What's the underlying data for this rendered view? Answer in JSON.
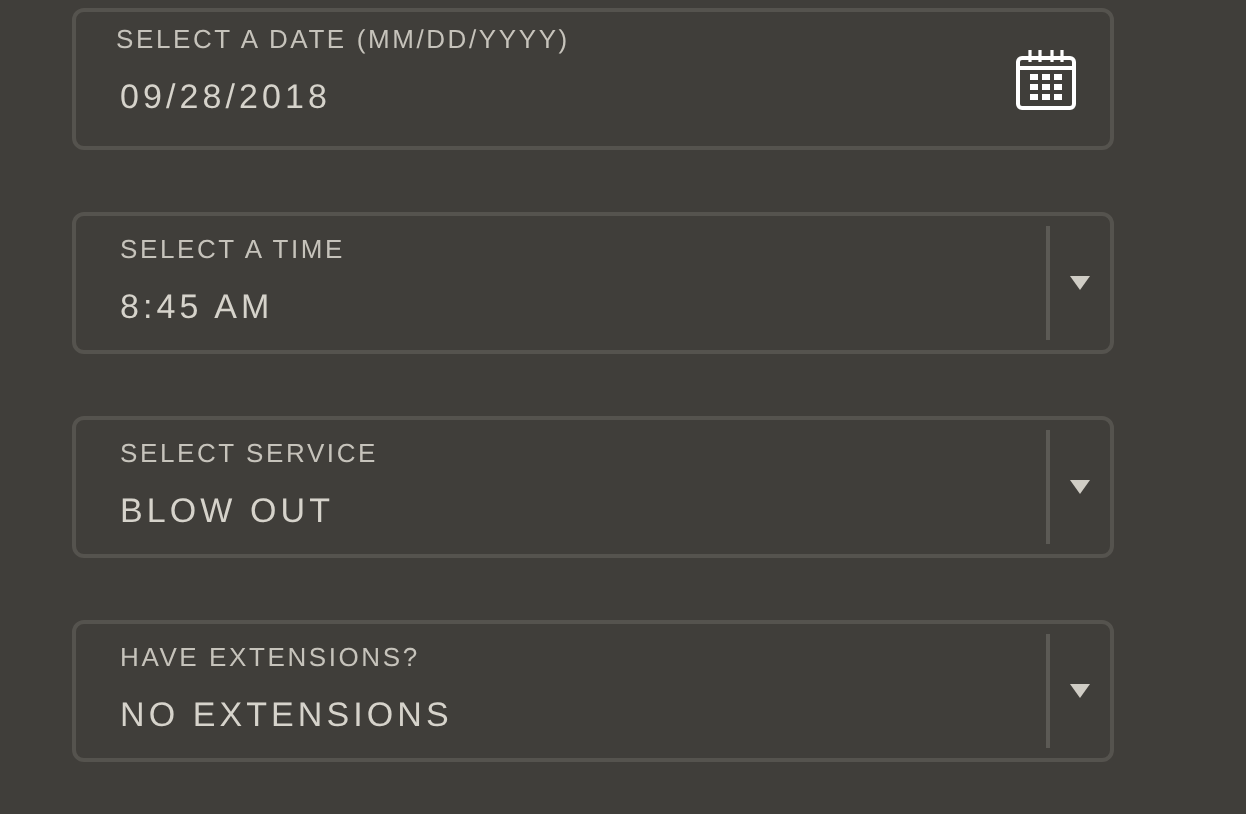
{
  "fields": [
    {
      "kind": "date",
      "label": "SELECT A DATE (MM/DD/YYYY)",
      "value": "09/28/2018"
    },
    {
      "kind": "select",
      "label": "SELECT A TIME",
      "value": "8:45 AM"
    },
    {
      "kind": "select",
      "label": "SELECT SERVICE",
      "value": "BLOW OUT"
    },
    {
      "kind": "select",
      "label": "HAVE EXTENSIONS?",
      "value": "NO EXTENSIONS"
    }
  ]
}
